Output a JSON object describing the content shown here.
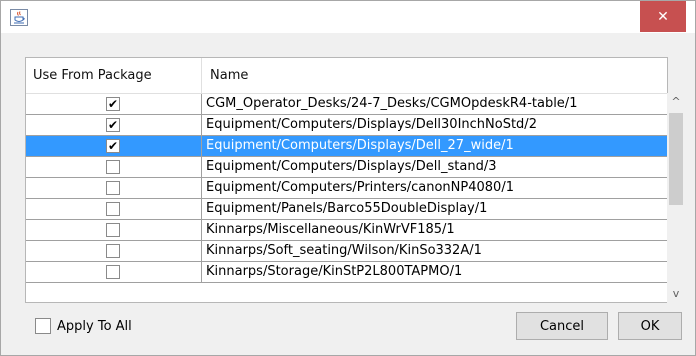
{
  "window": {
    "title_icon": "java-cup-icon",
    "close_icon": "close-icon",
    "close_label": "✕",
    "close_color": "#c75050"
  },
  "table": {
    "headers": [
      "Use From Package",
      "Name"
    ],
    "selected_color": "#3399ff",
    "rows": [
      {
        "checked": true,
        "name": "CGM_Operator_Desks/24-7_Desks/CGMOpdeskR4-table/1"
      },
      {
        "checked": true,
        "name": "Equipment/Computers/Displays/Dell30InchNoStd/2"
      },
      {
        "checked": true,
        "name": "Equipment/Computers/Displays/Dell_27_wide/1",
        "selected": true
      },
      {
        "checked": false,
        "name": "Equipment/Computers/Displays/Dell_stand/3"
      },
      {
        "checked": false,
        "name": "Equipment/Computers/Printers/canonNP4080/1"
      },
      {
        "checked": false,
        "name": "Equipment/Panels/Barco55DoubleDisplay/1"
      },
      {
        "checked": false,
        "name": "Kinnarps/Miscellaneous/KinWrVF185/1"
      },
      {
        "checked": false,
        "name": "Kinnarps/Soft_seating/Wilson/KinSo332A/1"
      },
      {
        "checked": false,
        "name": "Kinnarps/Storage/KinStP2L800TAPMO/1"
      }
    ],
    "check_mark": "✔"
  },
  "scrollbar": {
    "up_glyph": "^",
    "down_glyph": "v"
  },
  "footer": {
    "apply_all_label": "Apply To All",
    "apply_all_checked": false,
    "cancel_label": "Cancel",
    "ok_label": "OK"
  }
}
